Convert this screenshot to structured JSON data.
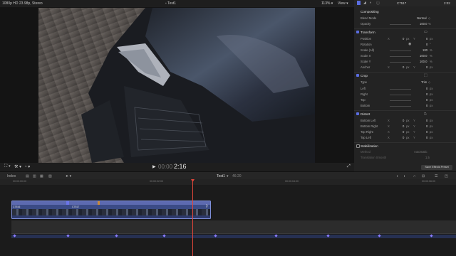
{
  "viewer": {
    "format_info": "1080p HD 23.98p, Stereo",
    "title": "Test1",
    "zoom": "113%",
    "view_label": "View",
    "timecode": "2:16"
  },
  "inspector": {
    "clip_name": "C7517",
    "duration": "2:02",
    "compositing": {
      "header": "Compositing",
      "blend_mode_label": "Blend Mode",
      "blend_mode_value": "Normal",
      "opacity_label": "Opacity",
      "opacity_value": "100.0",
      "opacity_unit": "%"
    },
    "transform": {
      "header": "Transform",
      "position_label": "Position",
      "position_x": "0",
      "position_y": "0",
      "rotation_label": "Rotation",
      "rotation_value": "0",
      "rotation_unit": "°",
      "scale_all_label": "Scale (All)",
      "scale_all_value": "100",
      "scale_x_label": "Scale X",
      "scale_x_value": "100.0",
      "scale_y_label": "Scale Y",
      "scale_y_value": "100.0",
      "anchor_label": "Anchor",
      "anchor_x": "0",
      "anchor_y": "0",
      "px": "px",
      "pct": "%",
      "x": "X",
      "y": "Y"
    },
    "crop": {
      "header": "Crop",
      "type_label": "Type",
      "type_value": "Trim",
      "left_label": "Left",
      "left_value": "0",
      "right_label": "Right",
      "right_value": "0",
      "top_label": "Top",
      "top_value": "0",
      "bottom_label": "Bottom",
      "bottom_value": "0"
    },
    "distort": {
      "header": "Distort",
      "bottom_left_label": "Bottom Left",
      "bottom_right_label": "Bottom Right",
      "top_right_label": "Top Right",
      "top_left_label": "Top Left",
      "zero": "0"
    },
    "stabilization": {
      "header": "Stabilization",
      "method_label": "Method",
      "method_value": "Automatic",
      "translation_label": "Translation Smooth",
      "translation_value": "1.5"
    },
    "save_preset": "Save Effects Preset"
  },
  "timeline": {
    "index_label": "Index",
    "project_name": "Test1",
    "project_duration": "46:20",
    "ruler": [
      "00:00:00:00",
      "00:00:02:00",
      "00:00:04:00",
      "00:00:06:00"
    ],
    "clip_label_1": "C7516",
    "clip_label_2": "C7517"
  },
  "colors": {
    "accent": "#5a6de0",
    "playhead": "#e0463a",
    "clip": "#3b4b86",
    "keyframe": "#8a7cff"
  }
}
